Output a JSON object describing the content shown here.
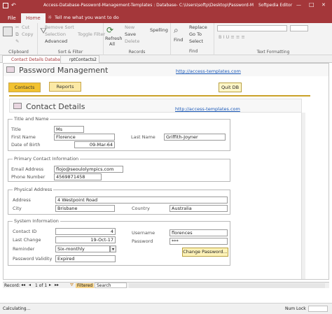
{
  "window": {
    "title": "Access-Database-Password-Management-Templates : Database- C:\\Users\\softp\\Desktop\\Password-M...",
    "brand": "Softpedia Editor",
    "minimize": "—",
    "maximize": "□",
    "close": "✕"
  },
  "ribbon_tabs": {
    "file": "File",
    "home": "Home",
    "tell_me": "Tell me what you want to do"
  },
  "ribbon": {
    "cut": "Cut",
    "copy": "Copy",
    "clipboard": "Clipboard",
    "remove_sort": "Remove Sort",
    "selection": "Selection",
    "advanced": "Advanced",
    "toggle_filter": "Toggle Filter",
    "sort_filter": "Sort & Filter",
    "refresh": "Refresh",
    "all": "All",
    "new": "New",
    "save": "Save",
    "delete": "Delete",
    "records": "Records",
    "spelling": "Spelling",
    "replace": "Replace",
    "goto": "Go To",
    "select": "Select",
    "find": "Find",
    "text_formatting": "Text Formatting"
  },
  "doc_tabs": {
    "tab1": "Contact Details Database",
    "tab2": "rptContacts2"
  },
  "form": {
    "title": "Password Management",
    "link": "http://access-templates.com",
    "contacts_button": "Contacts",
    "reports_button": "Reports",
    "quit_button": "Quit DB",
    "sub_title": "Contact Details",
    "sub_link": "http://access-templates.com"
  },
  "sections": {
    "title_name": {
      "heading": "Title and Name",
      "title_label": "Title",
      "title_value": "Ms",
      "first_label": "First Name",
      "first_value": "Florence",
      "last_label": "Last Name",
      "last_value": "Griffith-Joyner",
      "dob_label": "Date of Birth",
      "dob_value": "09-Mar-64"
    },
    "primary": {
      "heading": "Primary Contact Information",
      "email_label": "Email Address",
      "email_value": "flojo@seoulolympics.com",
      "phone_label": "Phone Number",
      "phone_value": "4569871458"
    },
    "physical": {
      "heading": "Physical Address",
      "address_label": "Address",
      "address_value": "4 Westpoint Road",
      "city_label": "City",
      "city_value": "Brisbane",
      "country_label": "Country",
      "country_value": "Australia"
    },
    "system": {
      "heading": "System Information",
      "contact_id_label": "Contact ID",
      "contact_id_value": "4",
      "last_change_label": "Last Change",
      "last_change_value": "19-Oct-17",
      "reminder_label": "Reminder",
      "reminder_value": "Six-monthly",
      "validity_label": "Password Validity",
      "validity_value": "Expired",
      "username_label": "Username",
      "username_value": "florences",
      "password_label": "Password",
      "password_value": "***",
      "change_button": "Change Password..."
    }
  },
  "record_nav": {
    "record_label": "Record:",
    "first": "◂◂",
    "prev": "◂",
    "position": "1 of 1",
    "next": "▸",
    "last": "▸▸",
    "filtered": "Filtered",
    "search": "Search"
  },
  "status": {
    "left": "Calculating...",
    "right": "Num Lock"
  },
  "colors": {
    "accent": "#a4373a",
    "gold_button": "#f2c230",
    "pale_button": "#fbe9a6",
    "divider": "#c9a128"
  }
}
